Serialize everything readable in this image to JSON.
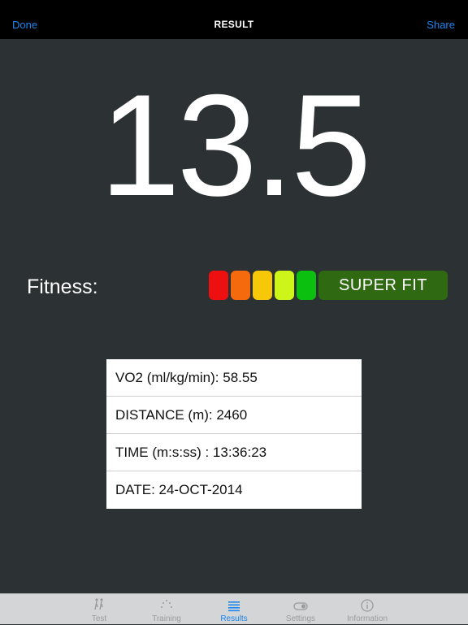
{
  "nav": {
    "left": "Done",
    "title": "RESULT",
    "right": "Share"
  },
  "score": "13.5",
  "fitness": {
    "label": "Fitness:",
    "level_colors": [
      "#ee1010",
      "#f46a0c",
      "#f6c808",
      "#cdf51a",
      "#0cc010"
    ],
    "badge": "SUPER FIT",
    "badge_color": "#2f6a12"
  },
  "results": [
    {
      "text": "VO2 (ml/kg/min): 58.55"
    },
    {
      "text": "DISTANCE (m): 2460"
    },
    {
      "text": "TIME (m:s:ss) : 13:36:23"
    },
    {
      "text": "DATE: 24-OCT-2014"
    }
  ],
  "tabs": [
    {
      "label": "Test",
      "icon": "runner-icon"
    },
    {
      "label": "Training",
      "icon": "dots-icon"
    },
    {
      "label": "Results",
      "icon": "list-icon",
      "active": true
    },
    {
      "label": "Settings",
      "icon": "toggle-icon"
    },
    {
      "label": "Information",
      "icon": "info-icon"
    }
  ],
  "colors": {
    "accent": "#1a86f0",
    "background": "#2c3133"
  }
}
